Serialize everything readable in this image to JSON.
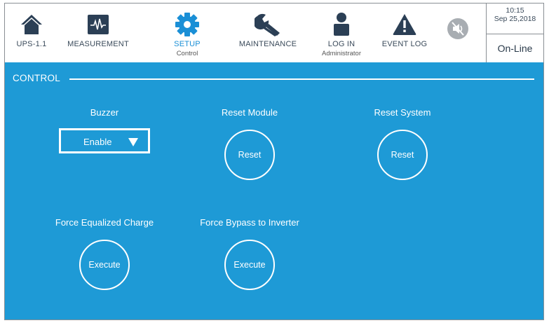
{
  "nav": {
    "items": [
      {
        "label": "UPS-1.1",
        "icon": "home-icon"
      },
      {
        "label": "MEASUREMENT",
        "icon": "waveform-icon"
      },
      {
        "label": "SETUP",
        "sublabel": "Control",
        "icon": "gear-icon"
      },
      {
        "label": "MAINTENANCE",
        "icon": "wrench-icon"
      },
      {
        "label": "LOG IN",
        "sublabel": "Administrator",
        "icon": "user-icon"
      },
      {
        "label": "EVENT LOG",
        "icon": "warning-icon"
      }
    ],
    "mute_icon": "speaker-muted-icon",
    "active_color": "#1a8fd6"
  },
  "clock": {
    "time": "10:15",
    "date": "Sep 25,2018"
  },
  "status": "On-Line",
  "section": {
    "title": "CONTROL"
  },
  "controls": {
    "buzzer": {
      "label": "Buzzer",
      "value": "Enable"
    },
    "reset_module": {
      "label": "Reset Module",
      "button": "Reset"
    },
    "reset_system": {
      "label": "Reset System",
      "button": "Reset"
    },
    "force_equalized_charge": {
      "label": "Force Equalized Charge",
      "button": "Execute"
    },
    "force_bypass": {
      "label": "Force Bypass to Inverter",
      "button": "Execute"
    }
  },
  "colors": {
    "panel_bg": "#1e9ad6",
    "icon_dark": "#2b3f55",
    "mute_bg": "#a8adb2"
  }
}
